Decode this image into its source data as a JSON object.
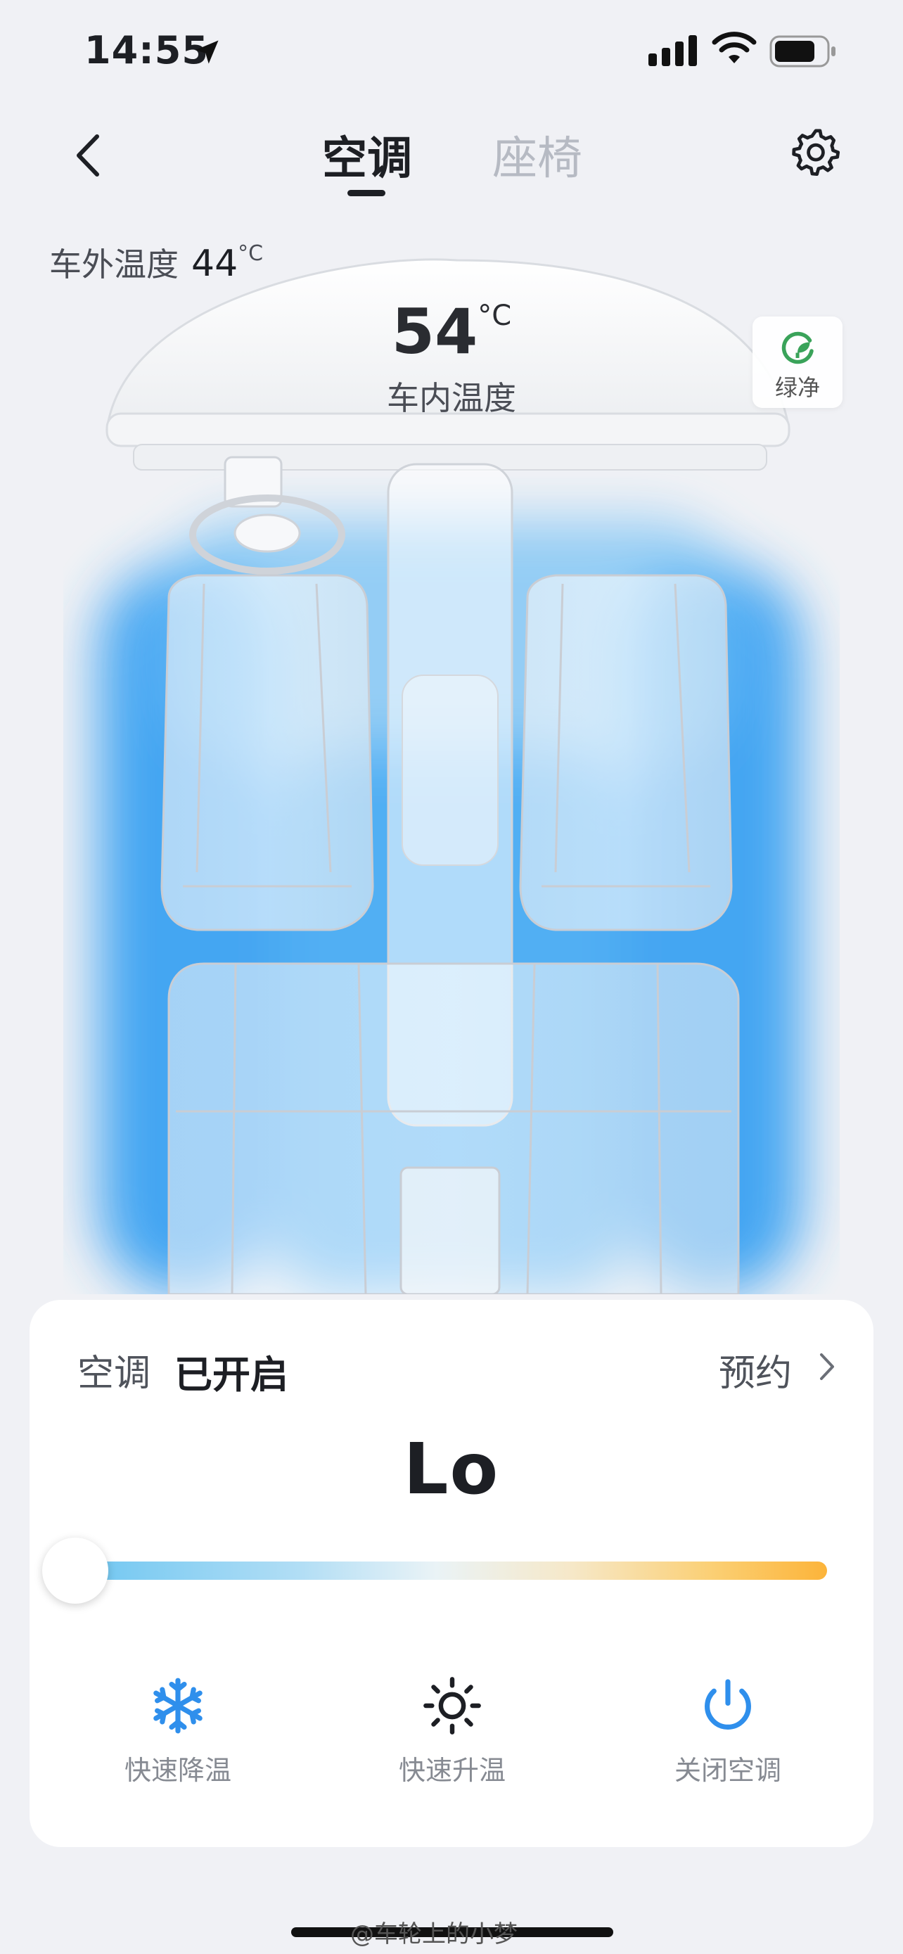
{
  "status_bar": {
    "time": "14:55"
  },
  "header": {
    "tabs": [
      {
        "label": "空调"
      },
      {
        "label": "座椅"
      }
    ]
  },
  "outside_temp": {
    "label": "车外温度",
    "value": "44",
    "unit": "°C"
  },
  "inside_temp": {
    "value": "54",
    "unit": "°C",
    "label": "车内温度"
  },
  "green_clean": {
    "label": "绿净"
  },
  "control_card": {
    "ac_label": "空调",
    "ac_status": "已开启",
    "schedule_label": "预约",
    "temperature_setting": "Lo",
    "slider_value_fraction": 0.0,
    "actions": [
      {
        "label": "快速降温",
        "icon": "snowflake-icon"
      },
      {
        "label": "快速升温",
        "icon": "sun-icon"
      },
      {
        "label": "关闭空调",
        "icon": "power-icon"
      }
    ]
  },
  "watermark": "@车轮上的小梦",
  "colors": {
    "accent_blue": "#2f8fec",
    "airflow_blue": "#3aa2f2",
    "slider_warm": "#fcb43a",
    "green": "#3aa35a"
  }
}
